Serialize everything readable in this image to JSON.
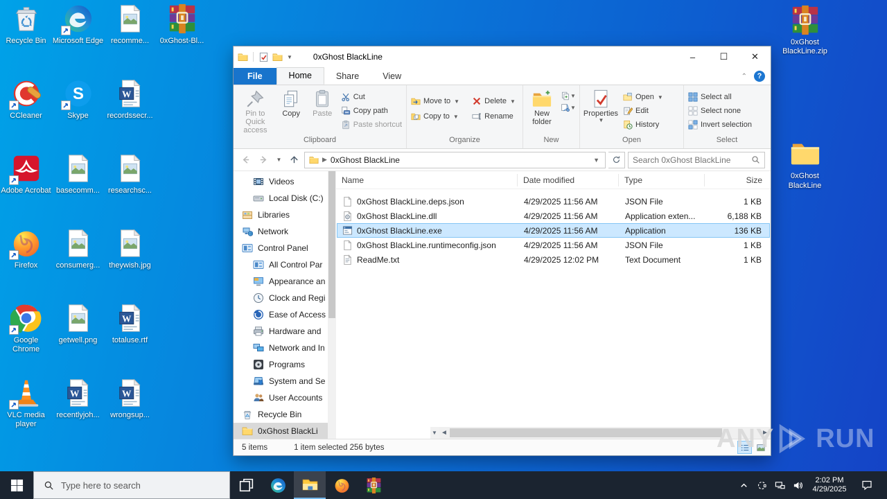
{
  "desktop": {
    "left_icons": [
      {
        "label": "Recycle Bin",
        "icon": "recycle",
        "shortcut": false
      },
      {
        "label": "CCleaner",
        "icon": "ccleaner",
        "shortcut": true
      },
      {
        "label": "Adobe Acrobat",
        "icon": "pdf",
        "shortcut": true
      },
      {
        "label": "Firefox",
        "icon": "firefox",
        "shortcut": true
      },
      {
        "label": "Google Chrome",
        "icon": "chrome",
        "shortcut": true
      },
      {
        "label": "VLC media player",
        "icon": "vlc",
        "shortcut": true
      },
      {
        "label": "Microsoft Edge",
        "icon": "edge",
        "shortcut": true
      },
      {
        "label": "Skype",
        "icon": "skype",
        "shortcut": true
      },
      {
        "label": "basecomm...",
        "icon": "image",
        "shortcut": false
      },
      {
        "label": "consumerg...",
        "icon": "image",
        "shortcut": false
      },
      {
        "label": "getwell.png",
        "icon": "image",
        "shortcut": false
      },
      {
        "label": "recentlyjoh...",
        "icon": "word",
        "shortcut": false
      },
      {
        "label": "recomme...",
        "icon": "image",
        "shortcut": false
      },
      {
        "label": "recordssecr...",
        "icon": "word",
        "shortcut": false
      },
      {
        "label": "researchsc...",
        "icon": "image",
        "shortcut": false
      },
      {
        "label": "theywish.jpg",
        "icon": "image",
        "shortcut": false
      },
      {
        "label": "totaluse.rtf",
        "icon": "word",
        "shortcut": false
      },
      {
        "label": "wrongsup...",
        "icon": "word",
        "shortcut": false
      },
      {
        "label": "0xGhost-Bl...",
        "icon": "winrar",
        "shortcut": false
      }
    ],
    "right_icons": [
      {
        "label": "0xGhost BlackLine.zip",
        "icon": "winrar",
        "shortcut": false
      },
      {
        "label": "0xGhost BlackLine",
        "icon": "folder",
        "shortcut": false,
        "gap": true
      }
    ]
  },
  "watermark": {
    "any": "ANY",
    "run": "RUN"
  },
  "window": {
    "title": "0xGhost BlackLine",
    "controls": {
      "minimize": "–",
      "maximize": "☐",
      "close": "✕"
    },
    "tabs": {
      "file": "File",
      "home": "Home",
      "share": "Share",
      "view": "View"
    },
    "ribbon": {
      "clipboard": {
        "pin": "Pin to Quick access",
        "copy": "Copy",
        "paste": "Paste",
        "cut": "Cut",
        "copy_path": "Copy path",
        "paste_shortcut": "Paste shortcut",
        "group": "Clipboard"
      },
      "organize": {
        "move_to": "Move to",
        "copy_to": "Copy to",
        "delete": "Delete",
        "rename": "Rename",
        "group": "Organize"
      },
      "new": {
        "new_folder": "New folder",
        "group": "New"
      },
      "open": {
        "properties": "Properties",
        "open": "Open",
        "edit": "Edit",
        "history": "History",
        "group": "Open"
      },
      "select": {
        "select_all": "Select all",
        "select_none": "Select none",
        "invert": "Invert selection",
        "group": "Select"
      }
    },
    "address": {
      "path": "0xGhost BlackLine",
      "search_placeholder": "Search 0xGhost BlackLine"
    },
    "nav": {
      "items": [
        {
          "label": "Videos",
          "icon": "videos",
          "indent": 1,
          "selected": false
        },
        {
          "label": "Local Disk (C:)",
          "icon": "disk",
          "indent": 1,
          "selected": false
        },
        {
          "label": "Libraries",
          "icon": "libraries",
          "indent": 0,
          "selected": false
        },
        {
          "label": "Network",
          "icon": "network",
          "indent": 0,
          "selected": false
        },
        {
          "label": "Control Panel",
          "icon": "cpanel",
          "indent": 0,
          "selected": false
        },
        {
          "label": "All Control Par",
          "icon": "cpanel",
          "indent": 1,
          "selected": false
        },
        {
          "label": "Appearance an",
          "icon": "appearance",
          "indent": 1,
          "selected": false
        },
        {
          "label": "Clock and Regi",
          "icon": "clock",
          "indent": 1,
          "selected": false
        },
        {
          "label": "Ease of Access",
          "icon": "ease",
          "indent": 1,
          "selected": false
        },
        {
          "label": "Hardware and",
          "icon": "hardware",
          "indent": 1,
          "selected": false
        },
        {
          "label": "Network and In",
          "icon": "netint",
          "indent": 1,
          "selected": false
        },
        {
          "label": "Programs",
          "icon": "programs",
          "indent": 1,
          "selected": false
        },
        {
          "label": "System and Se",
          "icon": "system",
          "indent": 1,
          "selected": false
        },
        {
          "label": "User Accounts",
          "icon": "users",
          "indent": 1,
          "selected": false
        },
        {
          "label": "Recycle Bin",
          "icon": "recyclesm",
          "indent": 0,
          "selected": false
        },
        {
          "label": "0xGhost BlackLi",
          "icon": "foldersm",
          "indent": 0,
          "selected": true
        }
      ]
    },
    "files": {
      "columns": [
        "Name",
        "Date modified",
        "Type",
        "Size"
      ],
      "rows": [
        {
          "name": "0xGhost BlackLine.deps.json",
          "modified": "4/29/2025 11:56 AM",
          "type": "JSON File",
          "size": "1 KB",
          "icon": "fjson",
          "selected": false
        },
        {
          "name": "0xGhost BlackLine.dll",
          "modified": "4/29/2025 11:56 AM",
          "type": "Application exten...",
          "size": "6,188 KB",
          "icon": "fdll",
          "selected": false
        },
        {
          "name": "0xGhost BlackLine.exe",
          "modified": "4/29/2025 11:56 AM",
          "type": "Application",
          "size": "136 KB",
          "icon": "fexe",
          "selected": true
        },
        {
          "name": "0xGhost BlackLine.runtimeconfig.json",
          "modified": "4/29/2025 11:56 AM",
          "type": "JSON File",
          "size": "1 KB",
          "icon": "fjson",
          "selected": false
        },
        {
          "name": "ReadMe.txt",
          "modified": "4/29/2025 12:02 PM",
          "type": "Text Document",
          "size": "1 KB",
          "icon": "ftxt",
          "selected": false
        }
      ]
    },
    "status": {
      "items": "5 items",
      "selection": "1 item selected 256 bytes"
    }
  },
  "taskbar": {
    "search_placeholder": "Type here to search",
    "time": "2:02 PM",
    "date": "4/29/2025"
  }
}
